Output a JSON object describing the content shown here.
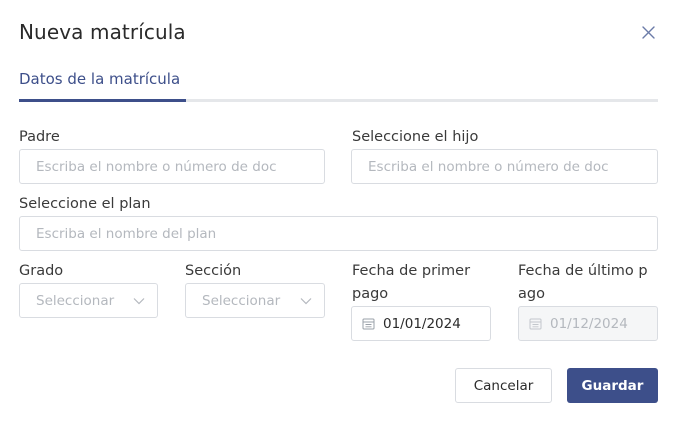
{
  "dialog": {
    "title": "Nueva matrícula"
  },
  "tabs": [
    {
      "label": "Datos de la matrícula",
      "active": true
    }
  ],
  "form": {
    "padre": {
      "label": "Padre",
      "placeholder": "Escriba el nombre o número de doc"
    },
    "hijo": {
      "label": "Seleccione el hijo",
      "placeholder": "Escriba el nombre o número de doc"
    },
    "plan": {
      "label": "Seleccione el plan",
      "placeholder": "Escriba el nombre del plan"
    },
    "grado": {
      "label": "Grado",
      "placeholder": "Seleccionar"
    },
    "seccion": {
      "label": "Sección",
      "placeholder": "Seleccionar"
    },
    "fecha_primer_pago": {
      "label_line1": "Fecha de primer",
      "label_line2": "pago",
      "value": "01/01/2024"
    },
    "fecha_ultimo_pago": {
      "label_line1": "Fecha de último p",
      "label_line2": "ago",
      "value": "01/12/2024",
      "disabled": true
    }
  },
  "actions": {
    "cancel_label": "Cancelar",
    "save_label": "Guardar"
  },
  "colors": {
    "accent": "#3d4f8a",
    "border": "#d9dce1",
    "placeholder": "#b4b8be",
    "disabled_bg": "#f5f6f7"
  },
  "icons": {
    "close": "close-icon",
    "chevron": "chevron-down-icon",
    "calendar": "calendar-icon"
  }
}
